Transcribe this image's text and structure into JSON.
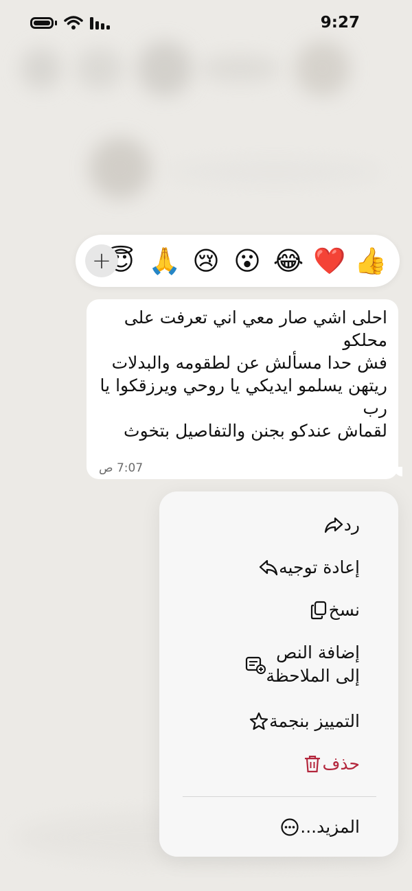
{
  "status": {
    "time": "9:27"
  },
  "reactions": {
    "emojis": [
      "👍",
      "❤️",
      "😂",
      "😮",
      "😢",
      "🙏",
      "😇"
    ],
    "add_label": "+"
  },
  "message": {
    "lines": [
      "احلى اشي صار معي اني تعرفت على",
      "محلكو",
      "فش حدا مسألش عن لطقومه والبدلات",
      "ريتهن يسلمو ايديكي يا روحي ويرزقكوا يا",
      "رب",
      "لقماش عندكو بجنن والتفاصيل بتخوث"
    ],
    "time": "7:07 ص"
  },
  "menu": {
    "reply": "رد",
    "forward": "إعادة توجيه",
    "copy": "نسخ",
    "add_note_line1": "إضافة النص",
    "add_note_line2": "إلى الملاحظة",
    "star": "التمييز بنجمة",
    "delete": "حذف",
    "more": "المزيد..."
  },
  "colors": {
    "danger": "#b3263c",
    "background": "#ecebe8"
  }
}
